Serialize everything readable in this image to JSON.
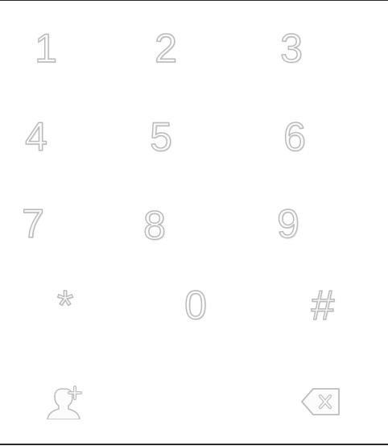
{
  "dialpad": {
    "keys": [
      {
        "label": "1"
      },
      {
        "label": "2"
      },
      {
        "label": "3"
      },
      {
        "label": "4"
      },
      {
        "label": "5"
      },
      {
        "label": "6"
      },
      {
        "label": "7"
      },
      {
        "label": "8"
      },
      {
        "label": "9"
      },
      {
        "label": "*"
      },
      {
        "label": "0"
      },
      {
        "label": "#"
      }
    ],
    "icons": {
      "add_contact": "add-contact-icon",
      "backspace": "backspace-icon"
    }
  },
  "colors": {
    "glyph_fill": "#fafafa",
    "glyph_stroke": "#b9b9b9",
    "rule": "#2b2b2b",
    "background": "#ffffff"
  }
}
